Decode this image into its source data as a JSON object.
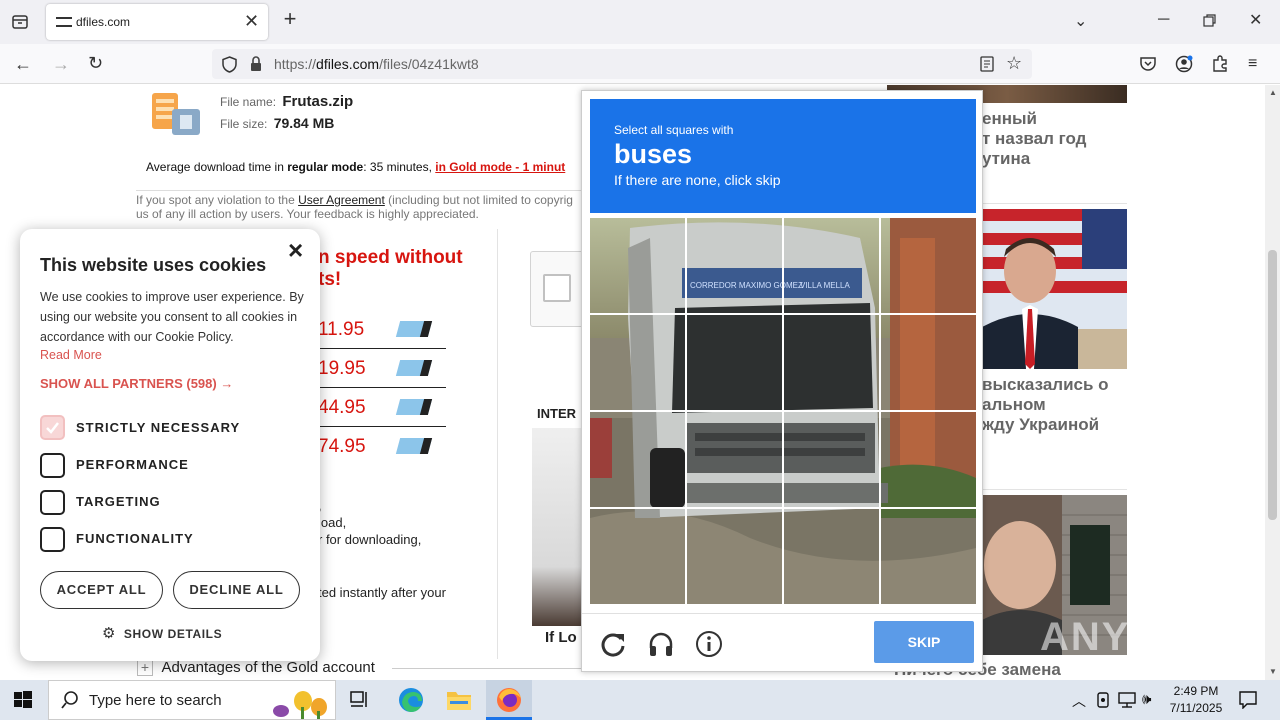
{
  "browser": {
    "tab_title": "dfiles.com",
    "new_tab": "+",
    "url_prefix": "https://",
    "url_host": "dfiles.com",
    "url_path": "/files/04z41kwt8"
  },
  "file": {
    "name_label": "File name:",
    "name": "Frutas.zip",
    "size_label": "File size:",
    "size": "79.84 MB",
    "avg_prefix": "Average download time in ",
    "avg_mode": "regular mode",
    "avg_value": ": 35 minutes, ",
    "avg_gold": "in Gold mode - 1 minut",
    "notice_1a": "If you spot any violation to the ",
    "notice_link": "User Agreement",
    "notice_1b": " (including but not limited to copyrig",
    "notice_2": "us of any ill action by users. Your feedback is highly appreciated."
  },
  "promo": {
    "heading_1": "n speed without",
    "heading_2": "ts!",
    "prices": [
      "11.95",
      "19.95",
      "44.95",
      "74.95"
    ],
    "frag_1": ",",
    "frag_2": "load,",
    "frag_3": "r for downloading,",
    "frag_4": "ted instantly after your",
    "advantages": "Advantages of the Gold account",
    "inter_label": "INTER",
    "if_lo": "If Lo"
  },
  "news": {
    "item1_1": "енный",
    "item1_2": "т назвал год",
    "item1_3": "утина",
    "item2_1": "высказались о",
    "item2_2": "альном",
    "item2_3": "жду Украиной",
    "item3": "Ничего себе замена"
  },
  "cookie": {
    "title": "This website uses cookies",
    "body": "We use cookies to improve user experience. By using our website you consent to all cookies in accordance with our Cookie Policy.",
    "read_more": "Read More",
    "show_partners": "SHOW ALL PARTNERS (598) →",
    "options": [
      "STRICTLY NECESSARY",
      "PERFORMANCE",
      "TARGETING",
      "FUNCTIONALITY"
    ],
    "accept": "ACCEPT ALL",
    "decline": "DECLINE ALL",
    "details": "SHOW DETAILS",
    "close": "×"
  },
  "captcha": {
    "line1": "Select all squares with",
    "target": "buses",
    "line2": "If there are none, click skip",
    "skip": "SKIP",
    "bus_sign_1": "CORREDOR MAXIMO GOMEZ",
    "bus_sign_2": "VILLA MELLA"
  },
  "watermark": "ANY RUN",
  "taskbar": {
    "search_placeholder": "Type here to search",
    "time": "2:49 PM",
    "date": "7/11/2025"
  },
  "colors": {
    "captcha_blue": "#1a73e8",
    "skip_blue": "#5b9be8",
    "red": "#d7150f",
    "cookie_accent": "#d9534f"
  }
}
